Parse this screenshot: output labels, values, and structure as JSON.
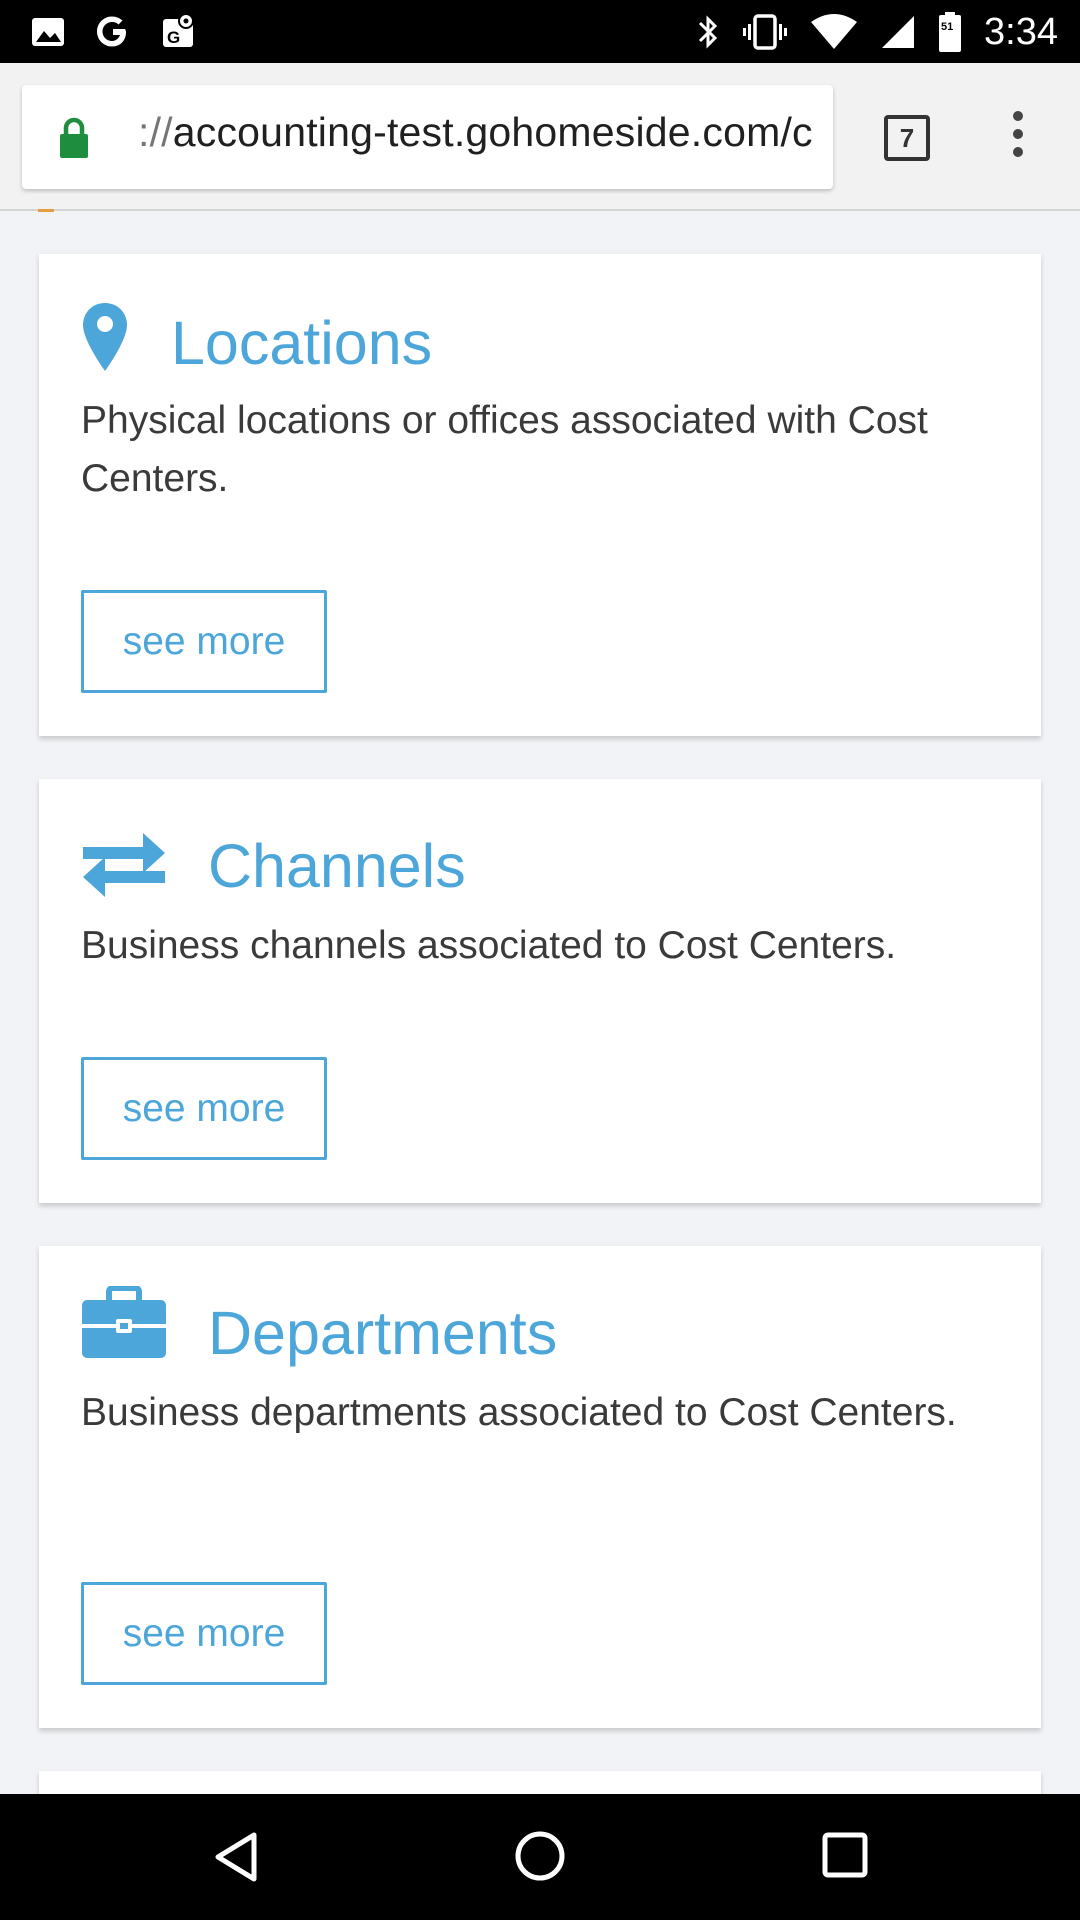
{
  "status_bar": {
    "time": "3:34",
    "left_icons": [
      "image-notification-icon",
      "google-notification-icon",
      "maps-notification-icon"
    ],
    "right_icons": [
      "bluetooth-icon",
      "vibrate-icon",
      "wifi-icon",
      "cell-signal-icon",
      "battery-icon"
    ],
    "battery_label": "51"
  },
  "browser": {
    "url_scheme": "://",
    "url_host": "accounting-test.gohomeside.com/c",
    "tab_count": "7",
    "colors": {
      "lock": "#1e8e3e"
    }
  },
  "cards": [
    {
      "title": "Locations",
      "icon": "map-pin-icon",
      "description": "Physical locations or offices associated with Cost Centers.",
      "button": "see more"
    },
    {
      "title": "Channels",
      "icon": "swap-arrows-icon",
      "description": "Business channels associated to Cost Centers.",
      "button": "see more"
    },
    {
      "title": "Departments",
      "icon": "briefcase-icon",
      "description": "Business departments associated to Cost Centers.",
      "button": "see more"
    }
  ],
  "nav_bar": {
    "icons": [
      "back-icon",
      "home-icon",
      "recents-icon"
    ]
  },
  "colors": {
    "accent": "#4da6da",
    "text": "#3a3a3a",
    "page_background": "#f1f3f6"
  }
}
